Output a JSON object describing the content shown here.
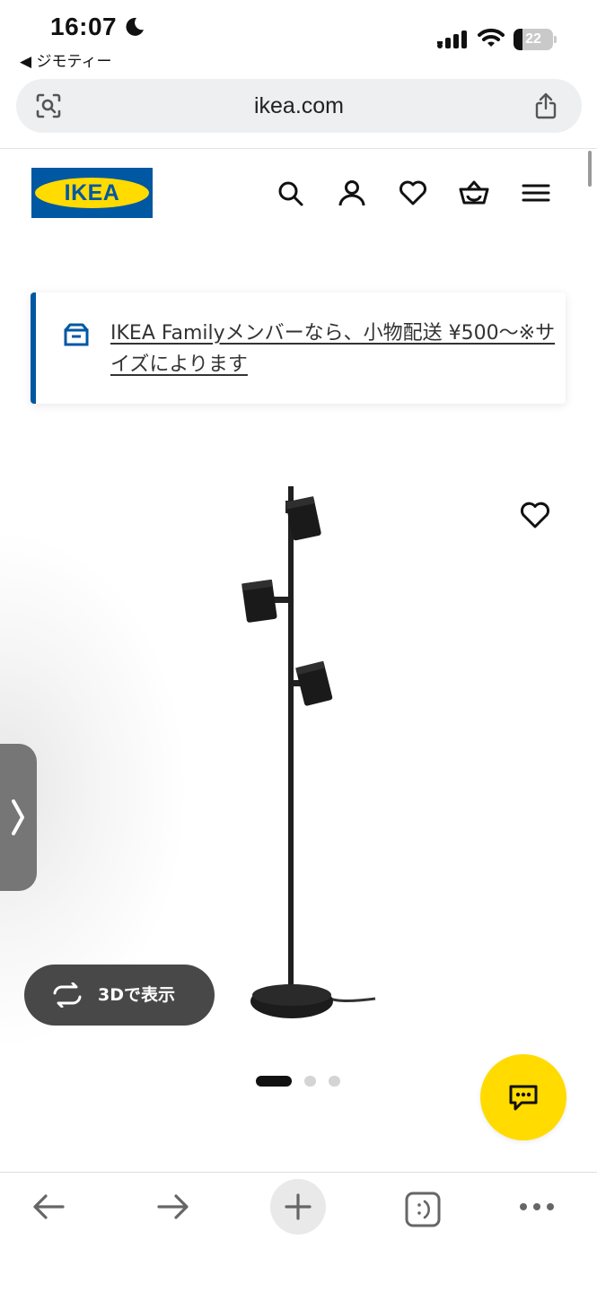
{
  "status_bar": {
    "time": "16:07",
    "back_app": "◀ ジモティー",
    "battery": "22",
    "battery_level": 0.22,
    "icons": [
      "moon-icon",
      "signal-icon",
      "wifi-icon",
      "battery-icon"
    ]
  },
  "browser": {
    "url": "ikea.com",
    "icons": [
      "visual-search-icon",
      "share-icon"
    ]
  },
  "header": {
    "logo_text": "IKEA",
    "colors": {
      "brand_blue": "#0058a3",
      "brand_yellow": "#ffdb00"
    },
    "icons": [
      "search-icon",
      "account-icon",
      "heart-icon",
      "cart-icon",
      "menu-icon"
    ]
  },
  "banner": {
    "text": "IKEA Familyメンバーなら、小物配送 ¥500〜※サイズによります",
    "icon": "delivery-box-icon"
  },
  "product": {
    "image": "black floor lamp with three spotlights",
    "view_3d_label": "3Dで表示",
    "gallery": {
      "count": 3,
      "active": 1
    }
  },
  "chat": {
    "icon": "chat-icon"
  },
  "bottom_bar": {
    "icons": [
      "back-arrow-icon",
      "forward-arrow-icon",
      "new-tab-icon",
      "tabs-icon",
      "more-icon"
    ]
  }
}
